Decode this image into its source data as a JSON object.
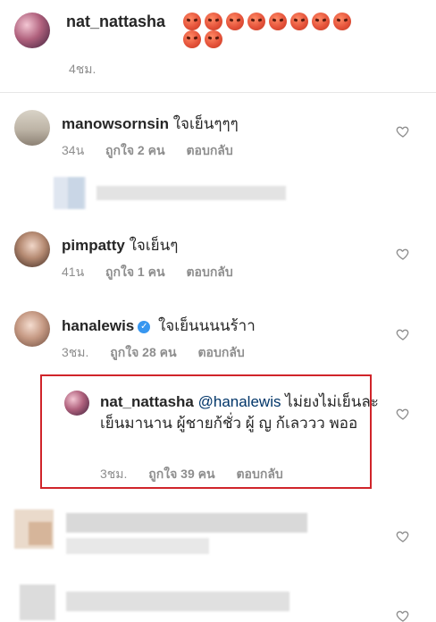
{
  "caption": {
    "username": "nat_nattasha",
    "emoji_icon": "angry-face-icon",
    "emoji_count": 10,
    "time": "4ชม."
  },
  "comments": [
    {
      "username": "manowsornsin",
      "text": "ใจเย็นๆๆๆ",
      "time": "34น",
      "likes": "ถูกใจ 2 คน",
      "reply": "ตอบกลับ"
    },
    {
      "username": "pimpatty",
      "text": "ใจเย็นๆ",
      "time": "41น",
      "likes": "ถูกใจ 1 คน",
      "reply": "ตอบกลับ"
    },
    {
      "username": "hanalewis",
      "verified": true,
      "text": "ใจเย็นนนนร้าา",
      "time": "3ชม.",
      "likes": "ถูกใจ 28 คน",
      "reply": "ตอบกลับ"
    }
  ],
  "reply": {
    "username": "nat_nattasha",
    "mention": "@hanalewis",
    "text": "ไม่ยงไม่เย็นละ เย็นมานาน ผู้ชายก้ชั่ว ผู้ ญ ก้เลววว พออ",
    "time": "3ชม.",
    "likes": "ถูกใจ 39 คน",
    "reply_label": "ตอบกลับ"
  },
  "colors": {
    "highlight_border": "#d0242a",
    "meta_text": "#8e8e8e",
    "mention": "#003569",
    "verified": "#3897f0"
  }
}
